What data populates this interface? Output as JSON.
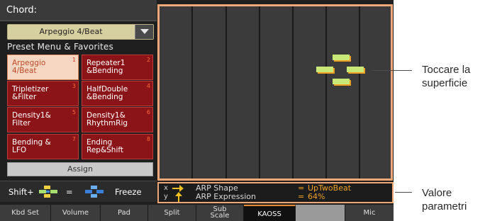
{
  "chord_header": "Chord:",
  "chord_select": {
    "value": "Arpeggio 4/Beat"
  },
  "preset_section_title": "Preset Menu & Favorites",
  "presets": [
    {
      "line1": "Arpeggio",
      "line2": "4/Beat",
      "num": "1",
      "selected": true
    },
    {
      "line1": "Repeater1",
      "line2": "&Bending",
      "num": "2",
      "selected": false
    },
    {
      "line1": "Tripletizer",
      "line2": "&Filter",
      "num": "3",
      "selected": false
    },
    {
      "line1": "HalfDouble",
      "line2": "&Bending",
      "num": "4",
      "selected": false
    },
    {
      "line1": "Density1&",
      "line2": "Filter",
      "num": "5",
      "selected": false
    },
    {
      "line1": "Density1&",
      "line2": "RhythmRig",
      "num": "6",
      "selected": false
    },
    {
      "line1": "Bending &",
      "line2": "LFO",
      "num": "7",
      "selected": false
    },
    {
      "line1": "Ending",
      "line2": "Rep&Shift",
      "num": "8",
      "selected": false
    }
  ],
  "assign_label": "Assign",
  "shift_bar": {
    "prefix": "Shift+",
    "equals": "=",
    "freeze_label": "Freeze"
  },
  "params": {
    "x_axis": "x",
    "y_axis": "y",
    "x_name": "ARP Shape",
    "y_name": "ARP Expression",
    "equals": "=",
    "x_value": "UpTwoBeat",
    "y_value": "64%"
  },
  "tabs": [
    {
      "label": "Kbd Set"
    },
    {
      "label": "Volume"
    },
    {
      "label": "Pad"
    },
    {
      "label": "Split"
    },
    {
      "label_line1": "Sub",
      "label_line2": "Scale"
    },
    {
      "label": "KAOSS"
    },
    {
      "label": ""
    },
    {
      "label": "Mic"
    }
  ],
  "callouts": {
    "touch_line1": "Toccare la",
    "touch_line2": "superficie",
    "value_line1": "Valore",
    "value_line2": "parametri"
  },
  "colors": {
    "accent_orange": "#f0a878",
    "param_value": "#f0a020",
    "preset_red": "#8a1418",
    "preset_selected": "#f7d7c2",
    "tab_active_line": "#e68a38"
  },
  "icons": [
    "dropdown-arrow-icon",
    "x-arrow-icon",
    "y-arrow-icon",
    "shift-gesture-icon",
    "freeze-gesture-icon",
    "touch-cursor-icon"
  ]
}
